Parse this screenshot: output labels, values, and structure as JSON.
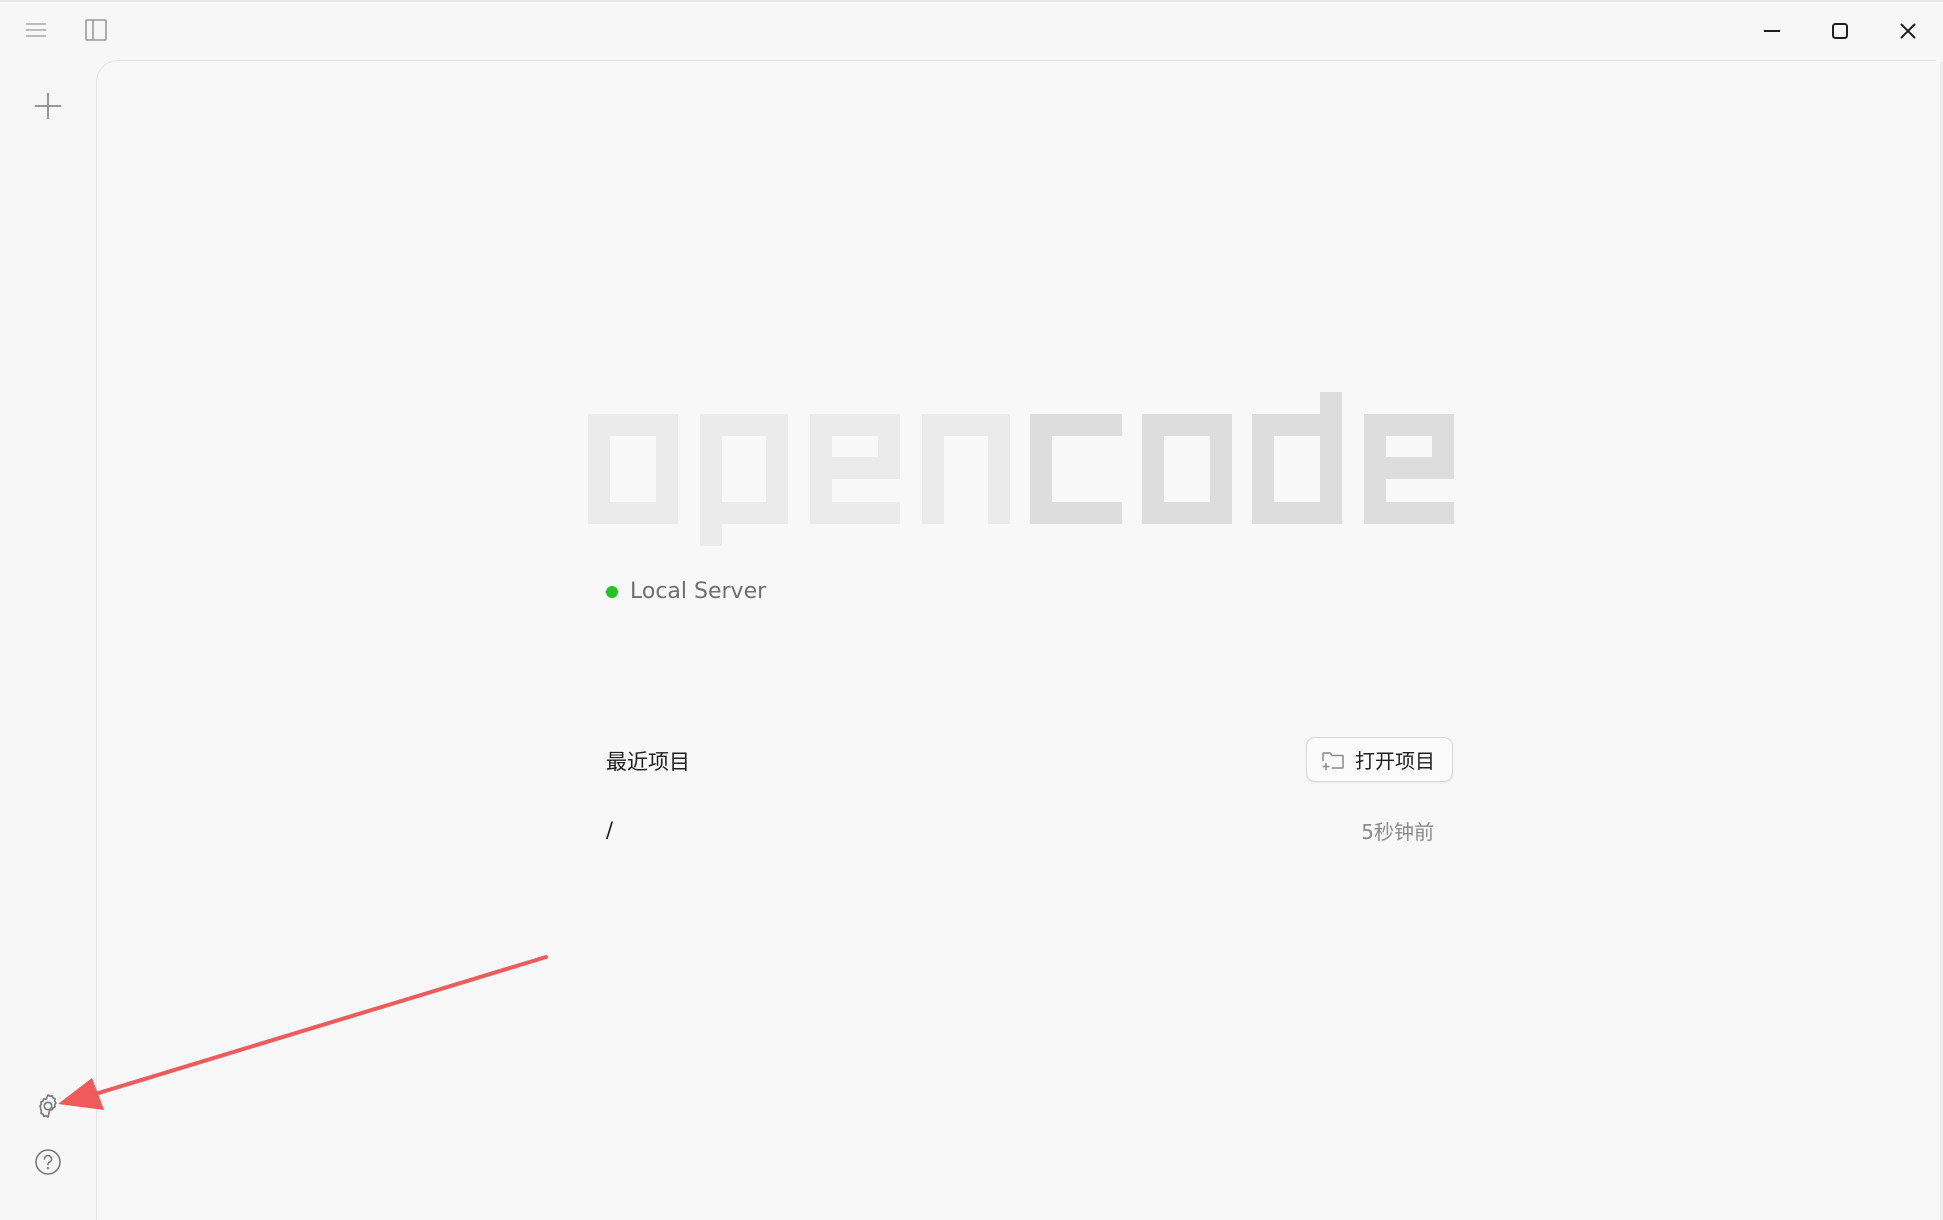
{
  "titlebar": {
    "menu_icon": "hamburger-menu-icon",
    "sidebar_toggle_icon": "sidebar-toggle-icon",
    "minimize_icon": "minimize-icon",
    "maximize_icon": "maximize-icon",
    "close_icon": "close-icon"
  },
  "sidebar": {
    "new_icon": "plus-icon",
    "settings_icon": "gear-icon",
    "help_icon": "help-icon"
  },
  "logo": {
    "text": "opencode"
  },
  "server": {
    "label": "Local Server",
    "status_color": "#22c322"
  },
  "recent": {
    "title": "最近项目",
    "open_button_label": "打开项目",
    "open_button_icon": "folder-add-icon",
    "projects": [
      {
        "path": "/",
        "time": "5秒钟前"
      }
    ]
  },
  "annotation": {
    "color": "#f05a5a",
    "target": "gear-icon"
  }
}
